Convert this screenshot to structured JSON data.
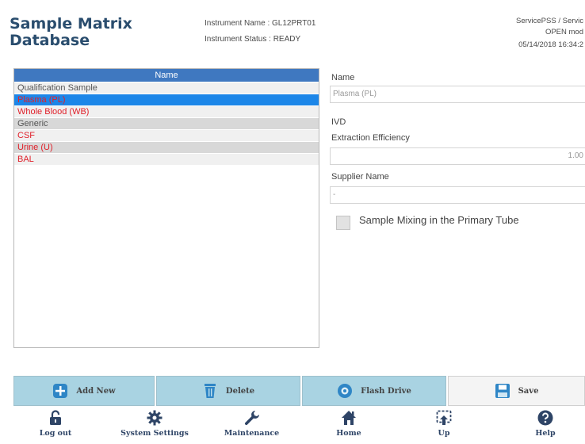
{
  "header": {
    "title": "Sample Matrix Database",
    "instrument_name": "Instrument Name : GL12PRT01",
    "instrument_status": "Instrument Status : READY",
    "user": "ServicePSS / Servic",
    "mode": "OPEN mod",
    "datetime": "05/14/2018 16:34:2"
  },
  "list": {
    "column_header": "Name",
    "items": [
      {
        "label": "Qualification Sample"
      },
      {
        "label": "Plasma (PL)"
      },
      {
        "label": "Whole Blood (WB)"
      },
      {
        "label": "Generic"
      },
      {
        "label": "CSF"
      },
      {
        "label": "Urine (U)"
      },
      {
        "label": "BAL"
      }
    ]
  },
  "form": {
    "name_label": "Name",
    "name_value": "Plasma (PL)",
    "ivd_label": "IVD",
    "extraction_label": "Extraction Efficiency",
    "extraction_value": "1.00",
    "supplier_label": "Supplier Name",
    "supplier_value": "-",
    "mixing_label": "Sample Mixing in the Primary Tube"
  },
  "actions": {
    "add_new": "Add New",
    "delete": "Delete",
    "flash_drive": "Flash Drive",
    "save": "Save"
  },
  "nav": {
    "log_out": "Log out",
    "system_settings": "System Settings",
    "maintenance": "Maintenance",
    "home": "Home",
    "up": "Up",
    "help": "Help"
  },
  "colors": {
    "title": "#2a4d6e",
    "list_header": "#3f78c0",
    "selected_row": "#1c86e8",
    "red_text": "#e0202a",
    "action_button": "#a9d3e2"
  }
}
